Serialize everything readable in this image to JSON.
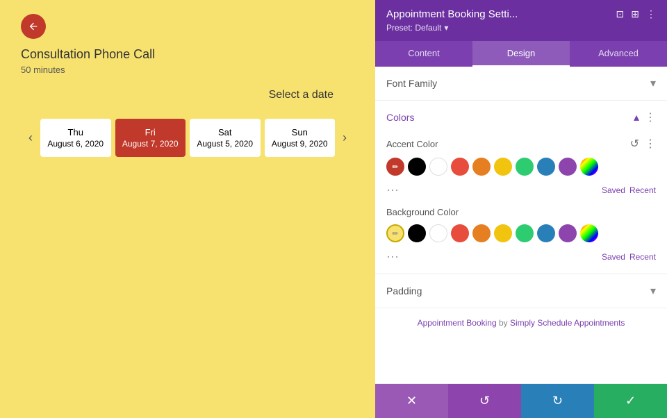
{
  "left": {
    "back_button_label": "←",
    "title": "Consultation Phone Call",
    "duration": "50 minutes",
    "select_date": "Select a date",
    "dates": [
      {
        "day": "Thu",
        "date": "August 6, 2020",
        "active": false
      },
      {
        "day": "Fri",
        "date": "August 7, 2020",
        "active": true
      },
      {
        "day": "Sat",
        "date": "August 5, 2020",
        "active": false
      },
      {
        "day": "Sun",
        "date": "August 9, 2020",
        "active": false
      }
    ],
    "prev_arrow": "‹",
    "next_arrow": "›"
  },
  "right": {
    "header": {
      "title": "Appointment Booking Setti...",
      "preset": "Preset: Default",
      "icons": [
        "⊡",
        "⊞",
        "⋮"
      ]
    },
    "tabs": [
      {
        "label": "Content",
        "active": false
      },
      {
        "label": "Design",
        "active": true
      },
      {
        "label": "Advanced",
        "active": false
      }
    ],
    "sections": {
      "font_family": {
        "label": "Font Family",
        "collapsed": true
      },
      "colors": {
        "label": "Colors",
        "collapsed": false,
        "accent_color": {
          "label": "Accent Color",
          "swatches": [
            {
              "color": "#c0392b",
              "name": "custom-red-swatch",
              "selected": true
            },
            {
              "color": "#000000",
              "name": "black-swatch"
            },
            {
              "color": "#ffffff",
              "name": "white-swatch"
            },
            {
              "color": "#e74c3c",
              "name": "red-swatch"
            },
            {
              "color": "#e67e22",
              "name": "orange-swatch"
            },
            {
              "color": "#f1c40f",
              "name": "yellow-swatch"
            },
            {
              "color": "#2ecc71",
              "name": "green-swatch"
            },
            {
              "color": "#2980b9",
              "name": "blue-swatch"
            },
            {
              "color": "#8e44ad",
              "name": "purple-swatch"
            },
            {
              "color": "gradient",
              "name": "gradient-swatch"
            }
          ],
          "saved_label": "Saved",
          "recent_label": "Recent"
        },
        "background_color": {
          "label": "Background Color",
          "swatches": [
            {
              "color": "#f7e270",
              "name": "custom-yellow-swatch",
              "selected": true
            },
            {
              "color": "#000000",
              "name": "black-swatch-bg"
            },
            {
              "color": "#ffffff",
              "name": "white-swatch-bg"
            },
            {
              "color": "#e74c3c",
              "name": "red-swatch-bg"
            },
            {
              "color": "#e67e22",
              "name": "orange-swatch-bg"
            },
            {
              "color": "#f1c40f",
              "name": "yellow-swatch-bg"
            },
            {
              "color": "#2ecc71",
              "name": "green-swatch-bg"
            },
            {
              "color": "#2980b9",
              "name": "blue-swatch-bg"
            },
            {
              "color": "#8e44ad",
              "name": "purple-swatch-bg"
            },
            {
              "color": "gradient",
              "name": "gradient-swatch-bg"
            }
          ],
          "saved_label": "Saved",
          "recent_label": "Recent"
        }
      },
      "padding": {
        "label": "Padding",
        "collapsed": true
      }
    },
    "attribution": {
      "text_before": "Appointment Booking",
      "by": " by ",
      "link_text": "Simply Schedule Appointments",
      "link": "#"
    },
    "toolbar": {
      "cancel_icon": "✕",
      "undo_icon": "↺",
      "redo_icon": "↻",
      "save_icon": "✓"
    }
  },
  "colors": {
    "purple_accent": "#7b3fb0",
    "red_accent": "#c0392b",
    "yellow_bg": "#f7e270"
  }
}
